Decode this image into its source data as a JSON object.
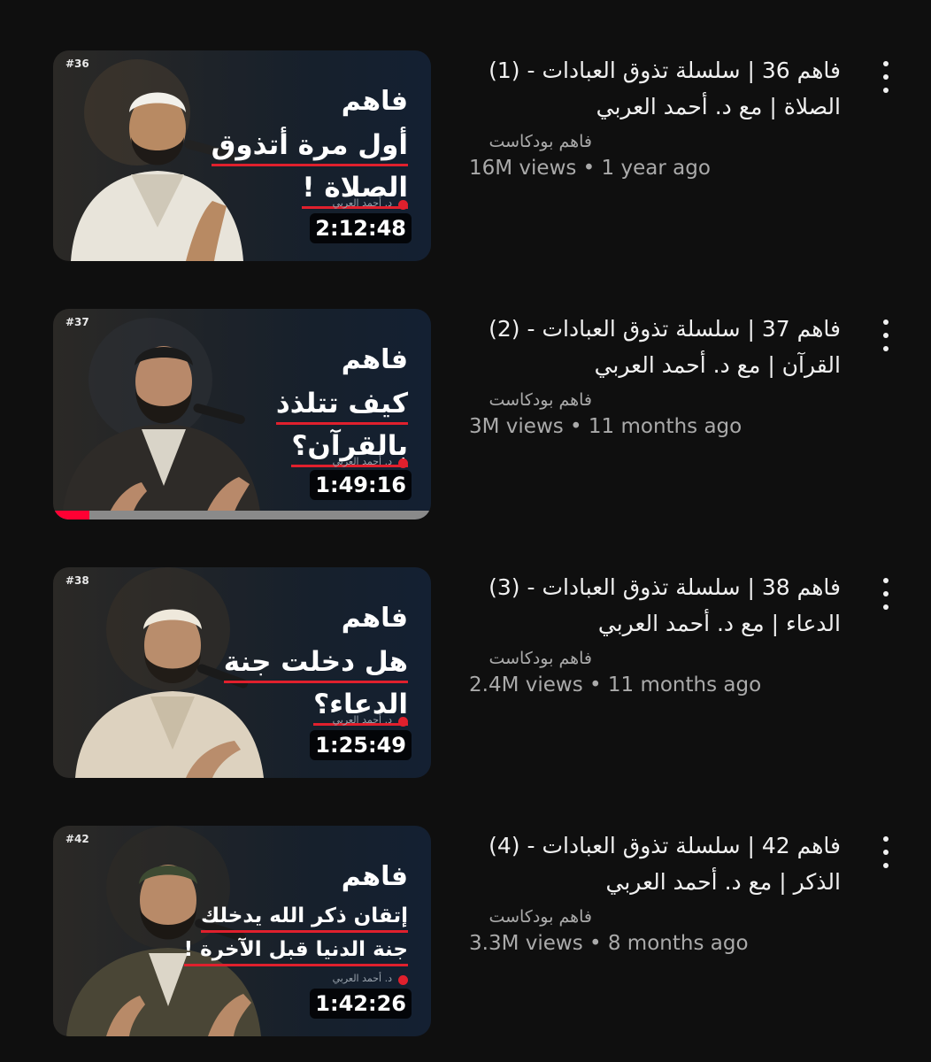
{
  "videos": [
    {
      "episode_tag": "#36",
      "brand": "فاهم",
      "headline": [
        "أول مرة أتذوق",
        "الصلاة !"
      ],
      "speaker_tag": "د. أحمد العربي",
      "duration": "2:12:48",
      "title": "فاهم 36 | سلسلة تذوق العبادات - (1) الصلاة | مع د. أحمد العربي",
      "channel": "فاهم بودكاست",
      "stats": "16M views • 1 year ago",
      "icon": "more-vert-icon"
    },
    {
      "episode_tag": "#37",
      "brand": "فاهم",
      "headline": [
        "كيف تتلذذ",
        "بالقرآن؟"
      ],
      "speaker_tag": "د. أحمد العربي",
      "duration": "1:49:16",
      "watch_progress": 0.095,
      "title": "فاهم 37 | سلسلة تذوق العبادات - (2) القرآن | مع د. أحمد العربي",
      "channel": "فاهم بودكاست",
      "stats": "3M views • 11 months ago",
      "icon": "more-vert-icon"
    },
    {
      "episode_tag": "#38",
      "brand": "فاهم",
      "headline": [
        "هل دخلت جنة",
        "الدعاء؟"
      ],
      "speaker_tag": "د. أحمد العربي",
      "duration": "1:25:49",
      "title": "فاهم 38 | سلسلة تذوق العبادات - (3) الدعاء | مع د. أحمد العربي",
      "channel": "فاهم بودكاست",
      "stats": "2.4M views • 11 months ago",
      "icon": "more-vert-icon"
    },
    {
      "episode_tag": "#42",
      "brand": "فاهم",
      "headline": [
        "إتقان ذكر الله يدخلك",
        "جنة الدنيا قبل الآخرة !"
      ],
      "speaker_tag": "د. أحمد العربي",
      "duration": "1:42:26",
      "title": "فاهم 42 | سلسلة تذوق العبادات - (4) الذكر | مع د. أحمد العربي",
      "channel": "فاهم بودكاست",
      "stats": "3.3M views • 8 months ago",
      "icon": "more-vert-icon"
    }
  ],
  "colors": {
    "background": "#0f0f0f",
    "title_text": "#f1f1f1",
    "secondary_text": "#aaaaaa",
    "progress_red": "#ff0033",
    "accent_red": "#e0202d"
  }
}
